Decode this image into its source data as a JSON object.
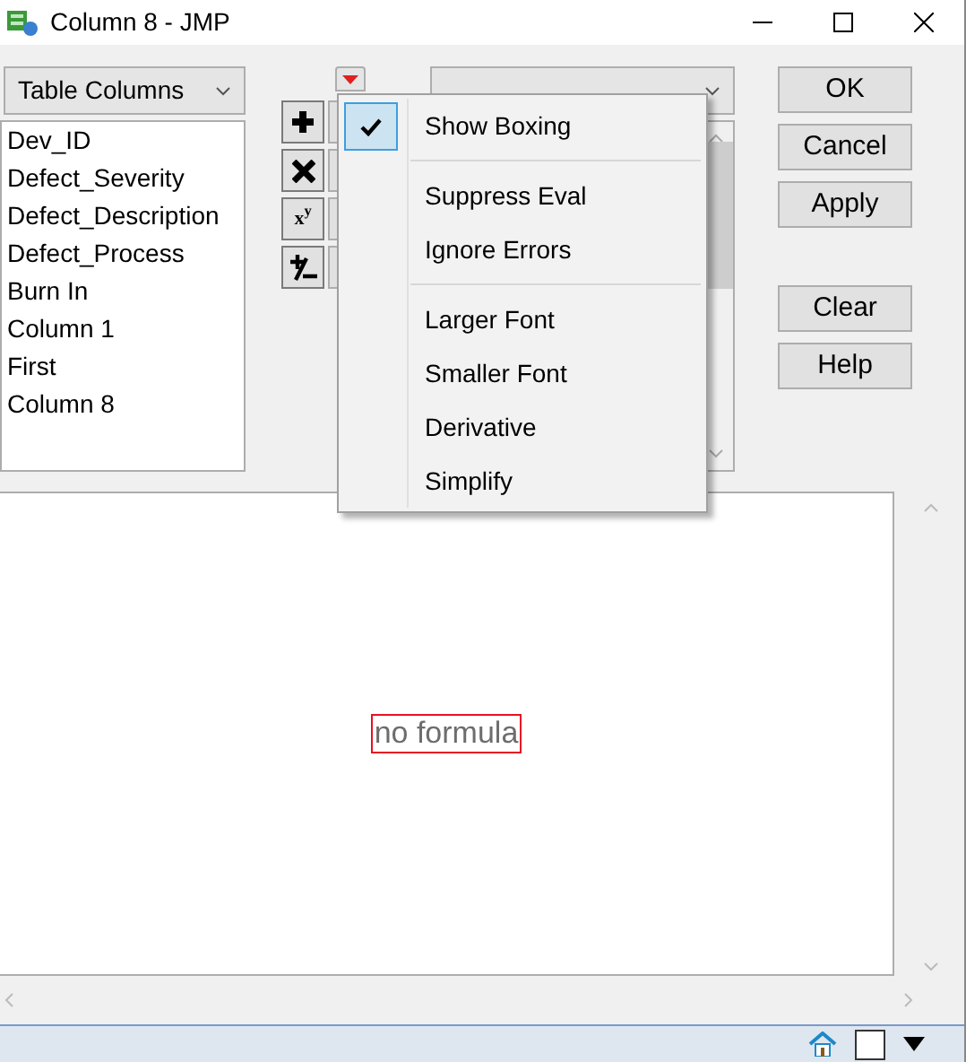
{
  "window": {
    "title": "Column 8 - JMP"
  },
  "columns_dropdown": {
    "label": "Table Columns"
  },
  "columns": [
    "Dev_ID",
    "Defect_Severity",
    "Defect_Description",
    "Defect_Process",
    "Burn In",
    "Column 1",
    "First",
    "Column 8"
  ],
  "operator_buttons": [
    {
      "kind": "plus"
    },
    {
      "kind": "times"
    },
    {
      "kind": "power",
      "label": "x$^{y}$"
    },
    {
      "kind": "plusminus"
    }
  ],
  "menu": {
    "groups": [
      [
        {
          "label": "Show Boxing",
          "checked": true
        }
      ],
      [
        {
          "label": "Suppress Eval",
          "checked": false
        },
        {
          "label": "Ignore Errors",
          "checked": false
        }
      ],
      [
        {
          "label": "Larger Font",
          "checked": false
        },
        {
          "label": "Smaller Font",
          "checked": false
        },
        {
          "label": "Derivative",
          "checked": false
        },
        {
          "label": "Simplify",
          "checked": false
        }
      ]
    ]
  },
  "buttons": [
    "OK",
    "Cancel",
    "Apply"
  ],
  "buttons_2": [
    "Clear",
    "Help"
  ],
  "formula": {
    "text": "no formula"
  }
}
